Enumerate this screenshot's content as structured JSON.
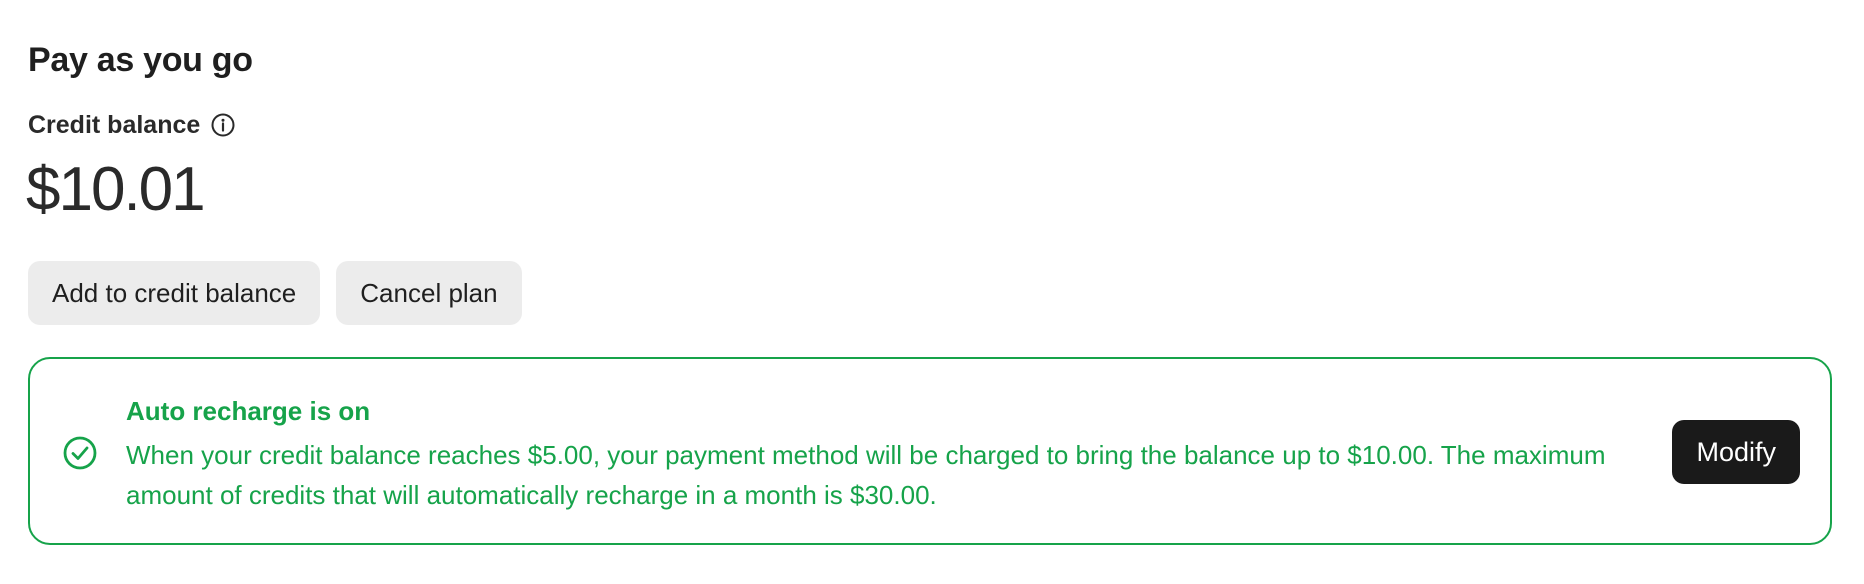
{
  "section": {
    "title": "Pay as you go"
  },
  "balance": {
    "label": "Credit balance",
    "info_icon": "info-circle-icon",
    "amount": "$10.01"
  },
  "actions": {
    "add_label": "Add to credit balance",
    "cancel_label": "Cancel plan"
  },
  "auto_recharge": {
    "status_icon": "check-circle-icon",
    "title": "Auto recharge is on",
    "message": "When your credit balance reaches $5.00, your payment method will be charged to bring the balance up to $10.00. The maximum amount of credits that will automatically recharge in a month is $30.00.",
    "modify_label": "Modify",
    "accent_color": "#16a34a"
  },
  "colors": {
    "text": "#1f1f1f",
    "button_gray": "#ececec",
    "button_dark": "#1a1a1a"
  }
}
